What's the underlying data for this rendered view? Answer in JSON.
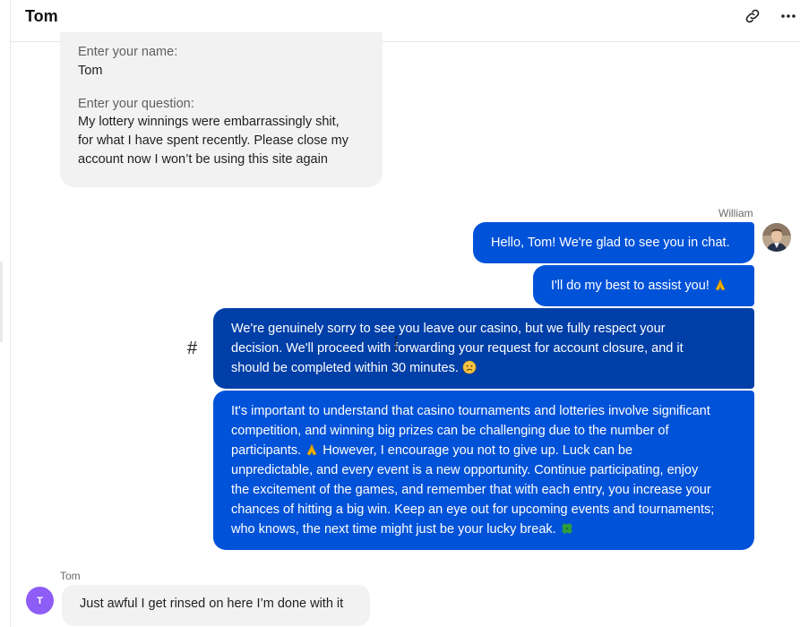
{
  "header": {
    "title": "Tom"
  },
  "form": {
    "name_label": "Enter your name:",
    "name_value": "Tom",
    "question_label": "Enter your question:",
    "question_lines": [
      "My lottery winnings were embarrassingly shit,",
      "for what I have spent recently. Please close my",
      "account now I won’t be using this site again"
    ]
  },
  "agent": {
    "name": "William",
    "messages": [
      {
        "lines": [
          "Hello, Tom! We're glad to see you in chat."
        ]
      },
      {
        "lines": [
          "I'll do my best to assist you!"
        ],
        "emoji": "pray-emoji"
      },
      {
        "lines": [
          "We're genuinely sorry to see you leave our casino, but we fully respect your",
          "decision. We'll proceed with forwarding your request for account closure, and it",
          "should be completed within 30 minutes."
        ],
        "emoji": "sad-emoji"
      },
      {
        "lines": [
          "It's important to understand that casino tournaments and lotteries involve significant",
          "competition, and winning big prizes can be challenging due to the number of",
          "participants.",
          "However, I encourage you not to give up. Luck can be",
          "unpredictable, and every event is a new opportunity. Continue participating, enjoy",
          "the excitement of the games, and remember that with each entry, you increase your",
          "chances of hitting a big win. Keep an eye out for upcoming events and tournaments;",
          "who knows, the next time might just be your lucky break."
        ]
      }
    ]
  },
  "hash_symbol": "#",
  "user": {
    "name": "Tom",
    "initial": "T",
    "message": "Just awful I get rinsed on here I’m done with it"
  },
  "colors": {
    "bubble_blue": "#0052d9",
    "bubble_dark": "#003fa8",
    "avatar_purple": "#8e5cf7",
    "gray_bubble": "#f2f2f2"
  }
}
